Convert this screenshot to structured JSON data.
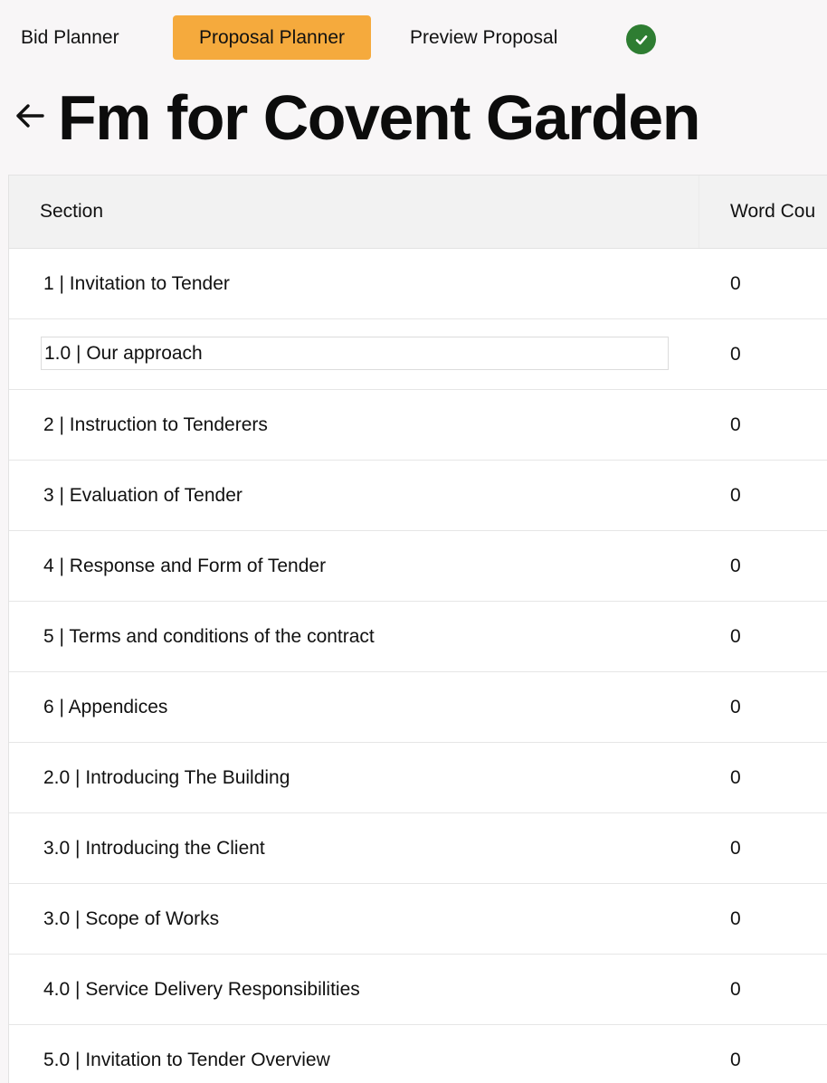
{
  "nav": {
    "tabs": [
      {
        "label": "Bid Planner",
        "active": false
      },
      {
        "label": "Proposal Planner",
        "active": true
      },
      {
        "label": "Preview Proposal",
        "active": false
      }
    ],
    "status_icon": "check-circle-icon",
    "accent_color": "#f5aa3d",
    "status_color": "#2e7d32"
  },
  "page": {
    "title": "Fm for Covent Garden",
    "back_icon": "arrow-left-icon"
  },
  "table": {
    "columns": [
      "Section",
      "Word Cou"
    ],
    "rows": [
      {
        "section": "1 | Invitation to Tender",
        "word_count": "0"
      },
      {
        "section": "1.0 | Our approach",
        "word_count": "0",
        "editing": true
      },
      {
        "section": "2 | Instruction to Tenderers",
        "word_count": "0"
      },
      {
        "section": "3 | Evaluation of Tender",
        "word_count": "0"
      },
      {
        "section": "4 | Response and Form of Tender",
        "word_count": "0"
      },
      {
        "section": "5 | Terms and conditions of the contract",
        "word_count": "0"
      },
      {
        "section": "6 | Appendices",
        "word_count": "0"
      },
      {
        "section": "2.0 | Introducing The Building",
        "word_count": "0"
      },
      {
        "section": "3.0 | Introducing the Client",
        "word_count": "0"
      },
      {
        "section": "3.0 | Scope of Works",
        "word_count": "0"
      },
      {
        "section": "4.0 | Service Delivery Responsibilities",
        "word_count": "0"
      },
      {
        "section": "5.0 | Invitation to Tender Overview",
        "word_count": "0"
      }
    ]
  }
}
